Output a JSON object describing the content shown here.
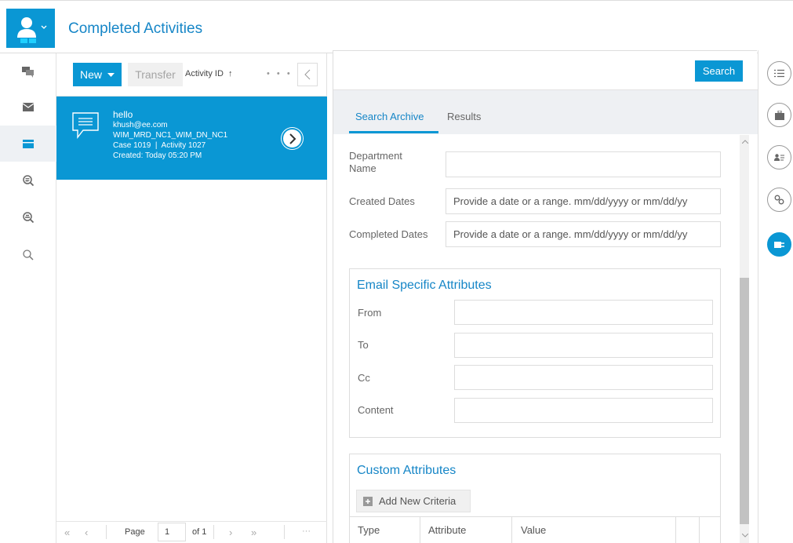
{
  "header": {
    "title": "Completed Activities"
  },
  "rail": {
    "icons": [
      "chat-icon",
      "email-icon",
      "folder-icon",
      "search-list-icon",
      "search-list-icon-2",
      "search-icon"
    ],
    "active_index": 2
  },
  "list": {
    "new_label": "New",
    "transfer_label": "Transfer",
    "sort_label": "Activity ID",
    "sort_arrow": "↑",
    "more": "• • •",
    "card": {
      "title": "hello",
      "email": "khush@ee.com",
      "queue": "WIM_MRD_NC1_WIM_DN_NC1",
      "case_activity": "Case 1019  |  Activity 1027",
      "created": "Created: Today 05:20 PM"
    },
    "pager": {
      "page_label": "Page",
      "page_value": "1",
      "of_label": "of 1",
      "more": "···"
    }
  },
  "detail": {
    "search_label": "Search",
    "tabs": [
      "Search Archive",
      "Results"
    ],
    "fields": {
      "department": {
        "label": "Department Name",
        "value": ""
      },
      "created": {
        "label": "Created Dates",
        "placeholder": "Provide a date or a range. mm/dd/yyyy or mm/dd/yy"
      },
      "completed": {
        "label": "Completed Dates",
        "placeholder": "Provide a date or a range. mm/dd/yyyy or mm/dd/yy"
      }
    },
    "email_section": {
      "title": "Email Specific Attributes",
      "labels": [
        "From",
        "To",
        "Cc",
        "Content"
      ]
    },
    "custom_section": {
      "title": "Custom Attributes",
      "add_label": "Add New Criteria",
      "columns": [
        "Type",
        "Attribute",
        "Value"
      ]
    }
  },
  "right_rail": {
    "icons": [
      "list-icon",
      "briefcase-icon",
      "contact-card-icon",
      "link-icon",
      "plugin-icon"
    ],
    "active_index": 4
  },
  "colors": {
    "accent": "#0a97d4",
    "title": "#1686c7"
  }
}
